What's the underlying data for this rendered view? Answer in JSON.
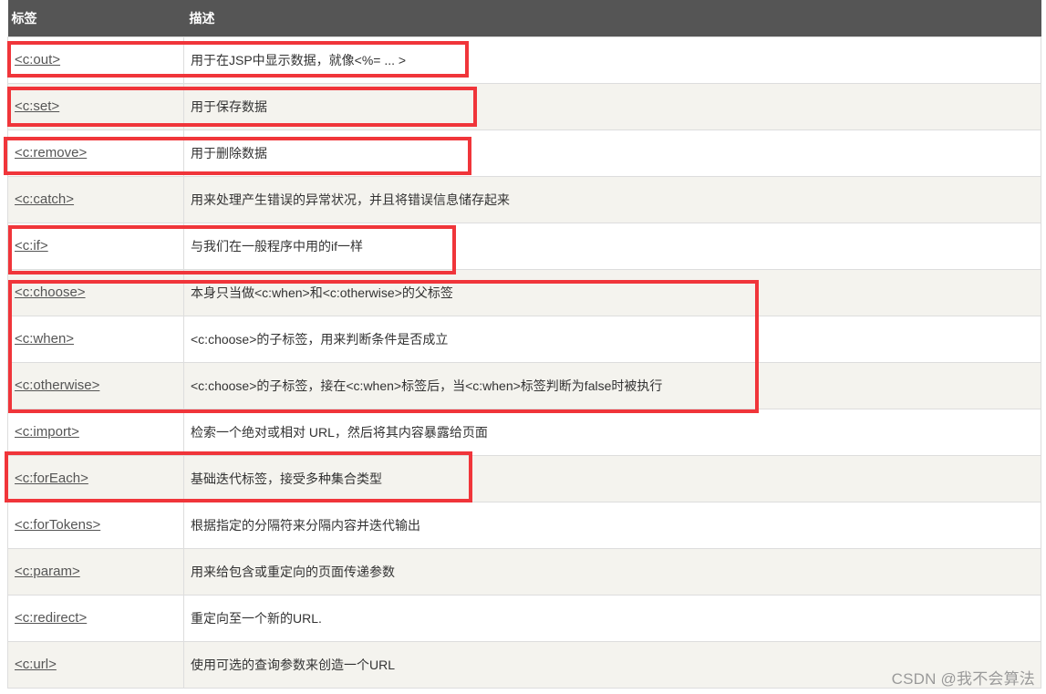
{
  "table": {
    "headers": [
      "标签",
      "描述"
    ],
    "rows": [
      {
        "tag": "<c:out>",
        "desc": "用于在JSP中显示数据，就像<%= ... >"
      },
      {
        "tag": "<c:set>",
        "desc": "用于保存数据"
      },
      {
        "tag": "<c:remove>",
        "desc": "用于删除数据"
      },
      {
        "tag": "<c:catch>",
        "desc": "用来处理产生错误的异常状况，并且将错误信息储存起来"
      },
      {
        "tag": "<c:if>",
        "desc": "与我们在一般程序中用的if一样"
      },
      {
        "tag": "<c:choose>",
        "desc": "本身只当做<c:when>和<c:otherwise>的父标签"
      },
      {
        "tag": "<c:when>",
        "desc": "<c:choose>的子标签，用来判断条件是否成立"
      },
      {
        "tag": "<c:otherwise>",
        "desc": "<c:choose>的子标签，接在<c:when>标签后，当<c:when>标签判断为false时被执行"
      },
      {
        "tag": "<c:import>",
        "desc": "检索一个绝对或相对 URL，然后将其内容暴露给页面"
      },
      {
        "tag": "<c:forEach>",
        "desc": "基础迭代标签，接受多种集合类型"
      },
      {
        "tag": "<c:forTokens>",
        "desc": "根据指定的分隔符来分隔内容并迭代输出"
      },
      {
        "tag": "<c:param>",
        "desc": "用来给包含或重定向的页面传递参数"
      },
      {
        "tag": "<c:redirect>",
        "desc": "重定向至一个新的URL."
      },
      {
        "tag": "<c:url>",
        "desc": "使用可选的查询参数来创造一个URL"
      }
    ]
  },
  "highlight_color": "#f0353a",
  "watermark": "CSDN @我不会算法"
}
